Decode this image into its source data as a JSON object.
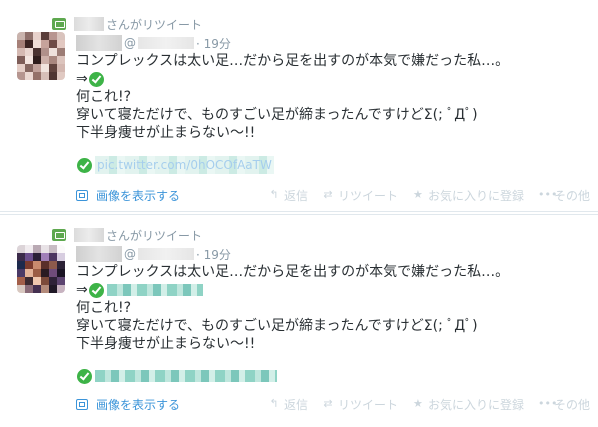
{
  "tweets": [
    {
      "retweet_text": "さんがリツイート",
      "handle_prefix": "@",
      "time": "· 19分",
      "lines": [
        "コンプレックスは太い足…だから足を出すのが本気で嫌だった私…。",
        "⇒",
        "何これ!?",
        "穿いて寝ただけで、ものすごい足が締まったんですけどΣ(; ﾟДﾟ)",
        "下半身痩せが止まらない〜!!"
      ],
      "link_text": "pic.twitter.com/0hOCOfAaTW",
      "expand_label": "画像を表示する",
      "actions": {
        "reply": "返信",
        "retweet": "リツイート",
        "favorite": "お気に入りに登録",
        "more": "その他"
      },
      "avatar": [
        "#c9b3ad",
        "#8e6f6a",
        "#e7d1cb",
        "#5a3d3a",
        "#b89590",
        "#d9c3bd",
        "#a68078",
        "#3c2422",
        "#f0ddd6",
        "#c6a39b",
        "#6e4b46",
        "#e2c8c1",
        "#d5b9b2",
        "#e9d5cf",
        "#4a3230",
        "#b0908a",
        "#efe1dc",
        "#9c7c75",
        "#7e5d58",
        "#f3e5e0",
        "#2f1d1c",
        "#cdb0a9",
        "#a9877f",
        "#dcc4bd",
        "#e5cec7",
        "#856660",
        "#c1a19a",
        "#f1e4de",
        "#62443f",
        "#d3b7b0",
        "#b69690",
        "#ebd8d2",
        "#947169",
        "#d7bfb8",
        "#4f3532",
        "#e0c9c2"
      ]
    },
    {
      "retweet_text": "さんがリツイート",
      "handle_prefix": "@",
      "time": "· 19分",
      "lines": [
        "コンプレックスは太い足…だから足を出すのが本気で嫌だった私…。",
        "⇒",
        "何これ!?",
        "穿いて寝ただけで、ものすごい足が締まったんですけどΣ(; ﾟДﾟ)",
        "下半身痩せが止まらない〜!!"
      ],
      "link_text": "",
      "expand_label": "画像を表示する",
      "actions": {
        "reply": "返信",
        "retweet": "リツイート",
        "favorite": "お気に入りに登録",
        "more": "その他"
      },
      "avatar": [
        "#dcd4d8",
        "#f1ecef",
        "#b9a9b3",
        "#e8e2e6",
        "#c7bcc3",
        "#fbf9fa",
        "#3b2b4a",
        "#6b4e8c",
        "#2a1f36",
        "#a07fb8",
        "#4c3660",
        "#d7cde0",
        "#1d2a4d",
        "#7b3b2e",
        "#c98a6e",
        "#5a2f2a",
        "#8d5a4c",
        "#2c2236",
        "#4a3a66",
        "#e3b49a",
        "#9b5d45",
        "#2a1b22",
        "#6f4c7a",
        "#1a1424",
        "#a35f4a",
        "#3c2a30",
        "#efc7ae",
        "#7c4a3a",
        "#2e2238",
        "#5c4470",
        "#d8c8c0",
        "#8a6b78",
        "#443050",
        "#b38a7a",
        "#1f1826",
        "#c7b3c0"
      ]
    }
  ]
}
